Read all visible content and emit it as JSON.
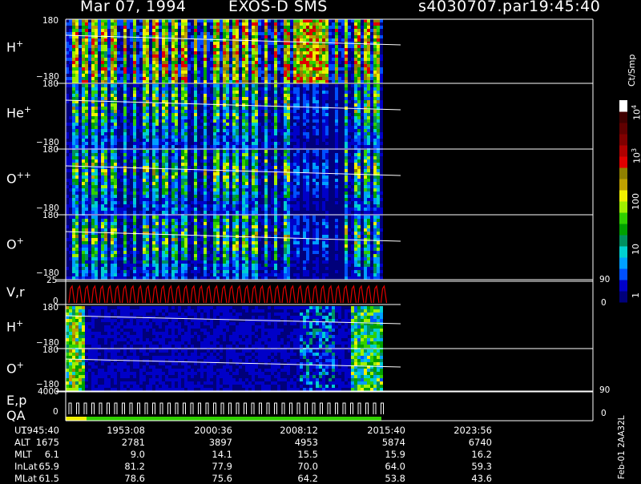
{
  "header": {
    "date": "Mar 07, 1994",
    "instrument": "EXOS-D SMS",
    "filename": "s4030707.par",
    "time": "19:45:40"
  },
  "panels": [
    {
      "species": "H",
      "charge": "+",
      "y_top": "180",
      "y_bottom": "−180"
    },
    {
      "species": "He",
      "charge": "+",
      "y_top": "180",
      "y_bottom": "−180"
    },
    {
      "species": "O",
      "charge": "++",
      "y_top": "180",
      "y_bottom": "−180"
    },
    {
      "species": "O",
      "charge": "+",
      "y_top": "180",
      "y_bottom": "−180"
    }
  ],
  "vr_panel": {
    "label": "V,r",
    "y_top": "25",
    "y_zero": "0",
    "right_top": "90",
    "right_zero": "0"
  },
  "low_panels": [
    {
      "species": "H",
      "charge": "+",
      "y_top": "180",
      "y_bottom": "−180"
    },
    {
      "species": "O",
      "charge": "+",
      "y_top": "180",
      "y_bottom": "−180"
    }
  ],
  "ep_panel": {
    "label1": "E,p",
    "label2": "QA",
    "y_top": "4000",
    "y_zero": "0",
    "right_top": "90",
    "right_zero": "0"
  },
  "colorbar": {
    "unit": "Ct/Smp",
    "tick_labels": [
      "1",
      "10",
      "100",
      "10",
      "10"
    ],
    "tick_exponents": [
      "",
      "",
      "",
      "3",
      "4"
    ],
    "colors": [
      "#00007a",
      "#0000c8",
      "#0050ff",
      "#00a0ff",
      "#00d0d0",
      "#009060",
      "#00a000",
      "#30d000",
      "#a0f000",
      "#f0f000",
      "#c0a000",
      "#908000",
      "#e00000",
      "#b00000",
      "#800000",
      "#600000",
      "#400000",
      "#ffffff"
    ]
  },
  "footer": {
    "row_labels": [
      "UT",
      "ALT",
      "MLT",
      "InLat",
      "MLat"
    ],
    "columns": [
      {
        "UT": "1945:40",
        "ALT": "1675",
        "MLT": "6.1",
        "InLat": "65.9",
        "MLat": "61.5"
      },
      {
        "UT": "1953:08",
        "ALT": "2781",
        "MLT": "9.0",
        "InLat": "81.2",
        "MLat": "78.6"
      },
      {
        "UT": "2000:36",
        "ALT": "3897",
        "MLT": "14.1",
        "InLat": "77.9",
        "MLat": "75.6"
      },
      {
        "UT": "2008:12",
        "ALT": "4953",
        "MLT": "15.5",
        "InLat": "70.0",
        "MLat": "64.2"
      },
      {
        "UT": "2015:40",
        "ALT": "5874",
        "MLT": "15.9",
        "InLat": "64.0",
        "MLat": "53.8"
      },
      {
        "UT": "2023:56",
        "ALT": "6740",
        "MLT": "16.2",
        "InLat": "59.3",
        "MLat": "43.6"
      }
    ],
    "side_note": "Feb-01  2AA32L"
  },
  "chart_data": {
    "type": "heatmap",
    "title": "Mar 07, 1994   EXOS-D SMS",
    "subtitle": "s4030707.par  19:45:40",
    "x_ticks": [
      "1945:40",
      "1953:08",
      "2000:36",
      "2008:12",
      "2015:40",
      "2023:56"
    ],
    "panels_y_range": [
      -180,
      180
    ],
    "colorbar_unit": "Ct/Smp",
    "colorbar_range": [
      1,
      10000
    ],
    "colorbar_scale": "log"
  }
}
